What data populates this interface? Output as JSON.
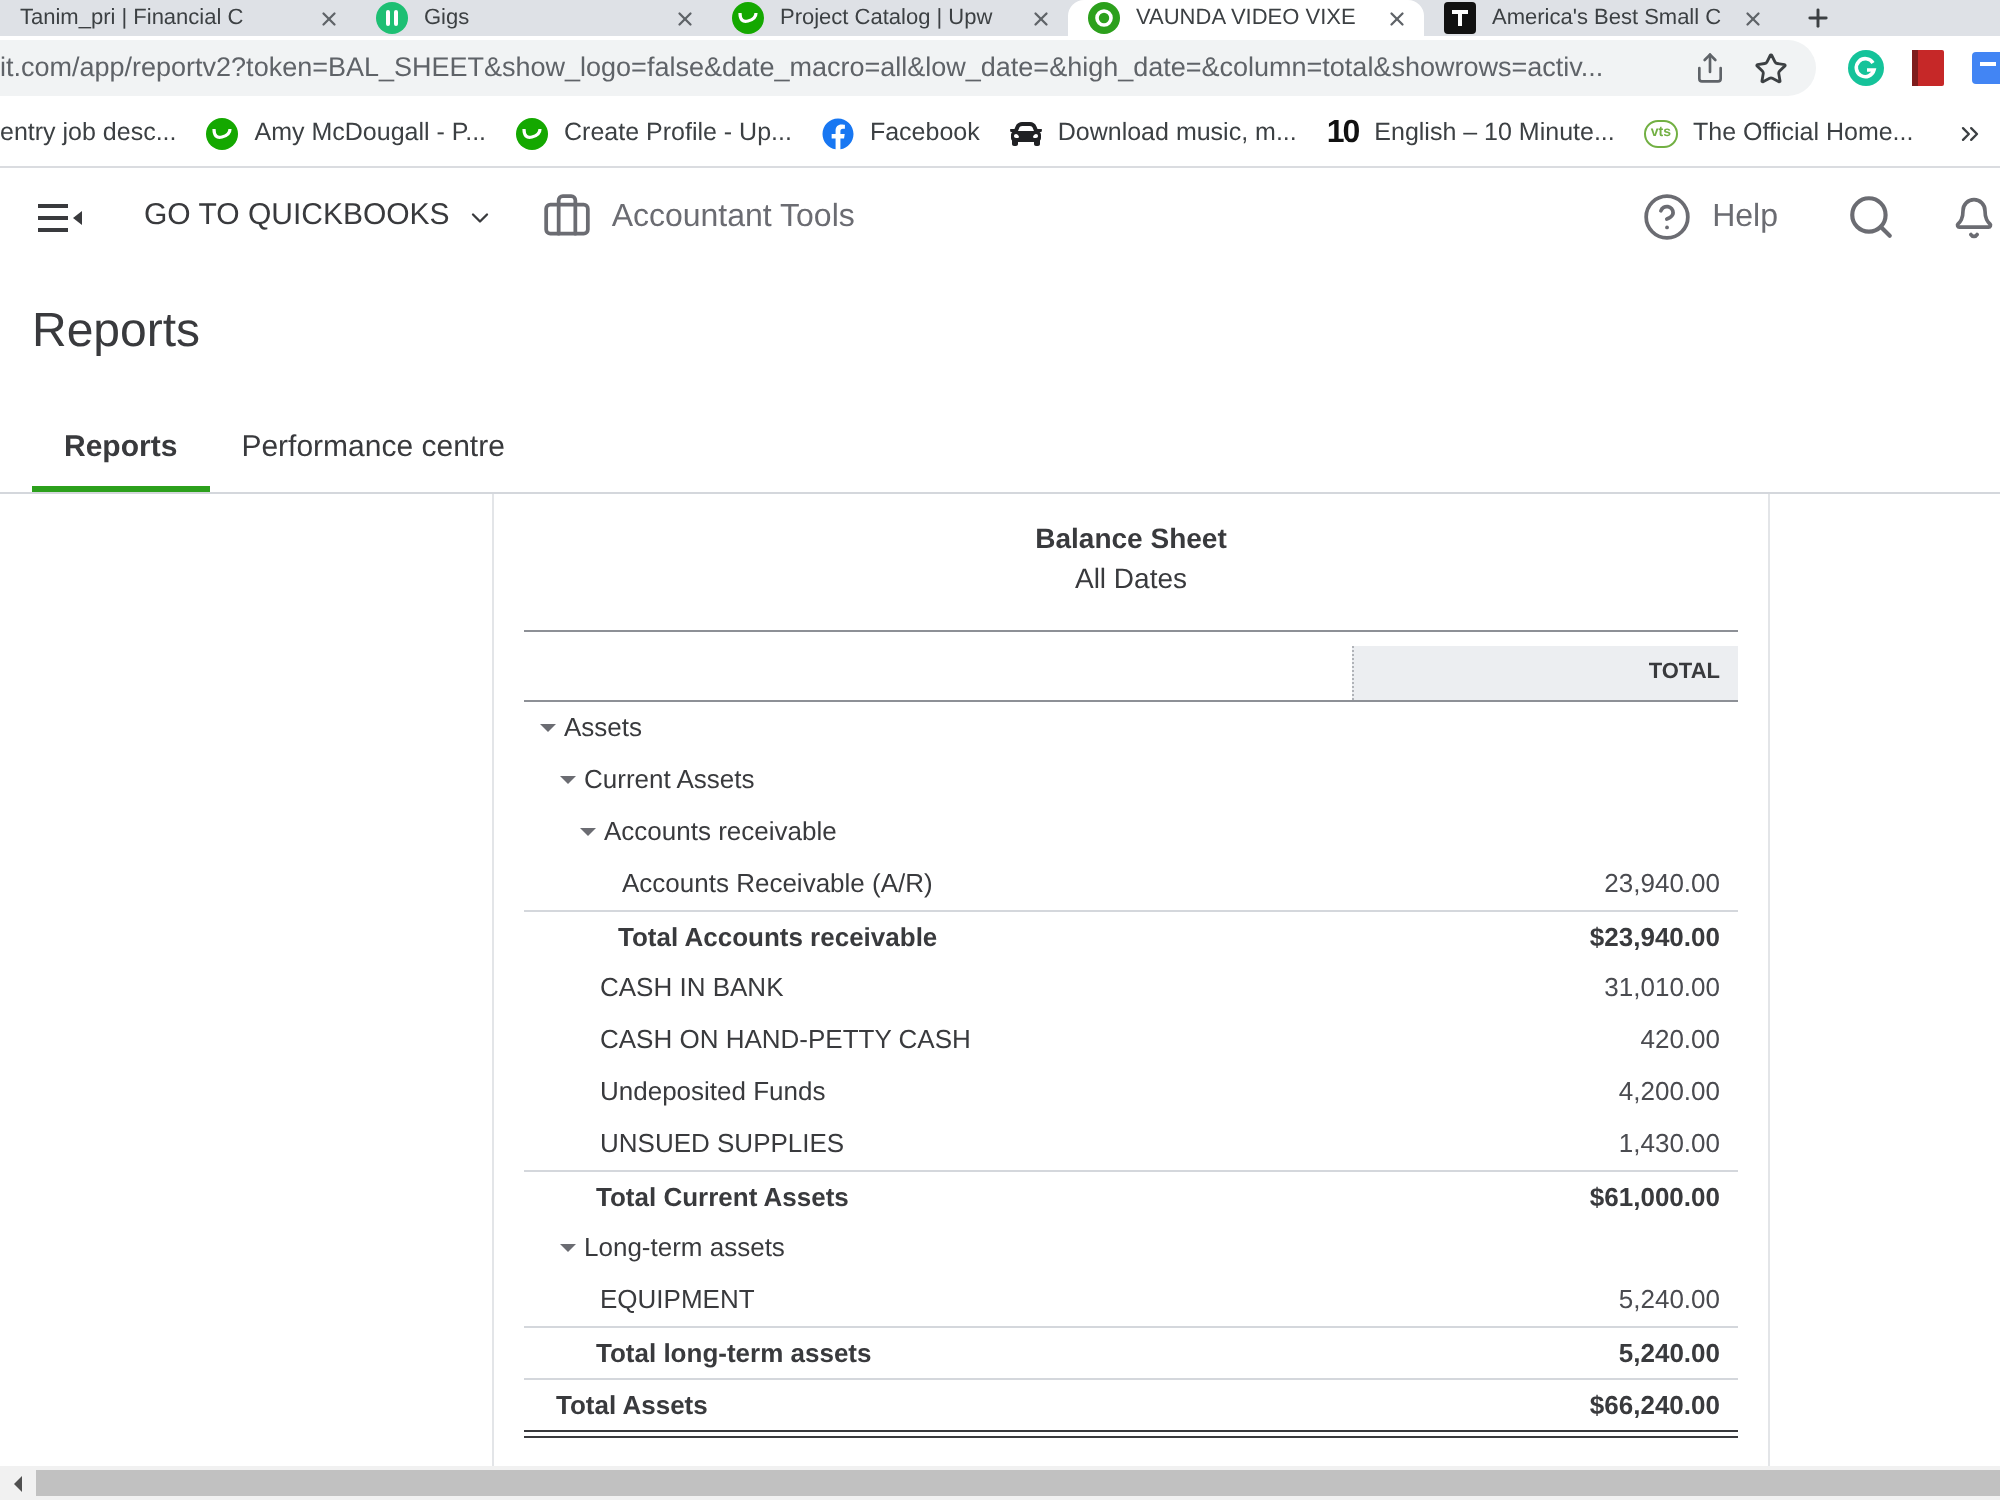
{
  "browser": {
    "tabs": [
      {
        "title": "Tanim_pri | Financial C",
        "selected": false
      },
      {
        "title": "Gigs",
        "selected": false
      },
      {
        "title": "Project Catalog | Upw",
        "selected": false
      },
      {
        "title": "VAUNDA VIDEO VIXE",
        "selected": true
      },
      {
        "title": "America's Best Small C",
        "selected": false
      }
    ],
    "address": "it.com/app/reportv2?token=BAL_SHEET&show_logo=false&date_macro=all&low_date=&high_date=&column=total&showrows=activ...",
    "bookmarks": [
      {
        "label": "entry job desc..."
      },
      {
        "label": "Amy McDougall - P..."
      },
      {
        "label": "Create Profile - Up..."
      },
      {
        "label": "Facebook"
      },
      {
        "label": "Download music, m..."
      },
      {
        "label": "English – 10 Minute...",
        "logo_text": "10"
      },
      {
        "label": "The Official Home...",
        "logo_text": "vts"
      }
    ]
  },
  "app_header": {
    "menu_label": "GO TO QUICKBOOKS",
    "tools_label": "Accountant Tools",
    "help_label": "Help"
  },
  "page": {
    "title": "Reports",
    "tabs": [
      {
        "label": "Reports",
        "selected": true
      },
      {
        "label": "Performance centre",
        "selected": false
      }
    ]
  },
  "report": {
    "title": "Balance Sheet",
    "period": "All Dates",
    "columns": [
      "TOTAL"
    ],
    "rows": [
      {
        "kind": "section",
        "label": "Assets",
        "expanded": true,
        "children": [
          {
            "kind": "section",
            "label": "Current Assets",
            "expanded": true,
            "children": [
              {
                "kind": "section",
                "label": "Accounts receivable",
                "expanded": true,
                "children": [
                  {
                    "kind": "account",
                    "label": "Accounts Receivable (A/R)",
                    "value": "23,940.00"
                  },
                  {
                    "kind": "total",
                    "label": "Total Accounts receivable",
                    "value": "$23,940.00"
                  }
                ]
              },
              {
                "kind": "account",
                "label": "CASH IN BANK",
                "value": "31,010.00"
              },
              {
                "kind": "account",
                "label": "CASH ON HAND-PETTY CASH",
                "value": "420.00"
              },
              {
                "kind": "account",
                "label": "Undeposited Funds",
                "value": "4,200.00"
              },
              {
                "kind": "account",
                "label": "UNSUED SUPPLIES",
                "value": "1,430.00"
              },
              {
                "kind": "total",
                "label": "Total Current Assets",
                "value": "$61,000.00"
              }
            ]
          },
          {
            "kind": "section",
            "label": "Long-term assets",
            "expanded": true,
            "children": [
              {
                "kind": "account",
                "label": "EQUIPMENT",
                "value": "5,240.00"
              },
              {
                "kind": "total",
                "label": "Total long-term assets",
                "value": "5,240.00"
              }
            ]
          },
          {
            "kind": "grand_total",
            "label": "Total Assets",
            "value": "$66,240.00"
          }
        ]
      }
    ]
  }
}
